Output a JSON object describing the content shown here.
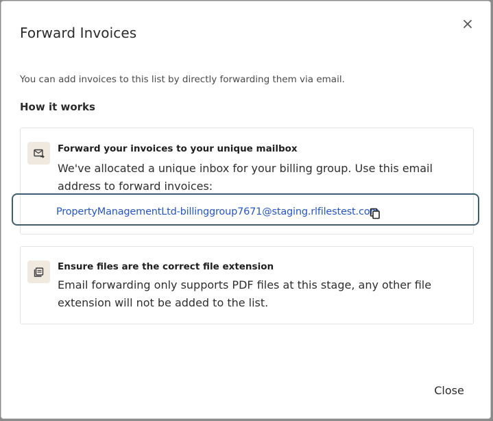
{
  "dialog": {
    "title": "Forward Invoices",
    "intro": "You can add invoices to this list by directly forwarding them via email.",
    "section_heading": "How it works",
    "close_label": "Close"
  },
  "cards": [
    {
      "icon": "mail-forward-icon",
      "title": "Forward your invoices to your unique mailbox",
      "description": "We've allocated a unique inbox for your billing group. Use this email address to forward invoices:",
      "email": "PropertyManagementLtd-billinggroup7671@staging.rlfilestest.com"
    },
    {
      "icon": "file-extension-icon",
      "title": "Ensure files are the correct file extension",
      "description": "Email forwarding only supports PDF files at this stage, any other file extension will not be added to the list."
    }
  ],
  "colors": {
    "link": "#2456c7",
    "highlight_border": "#3c5e70",
    "icon_bg": "#efe9e0"
  }
}
